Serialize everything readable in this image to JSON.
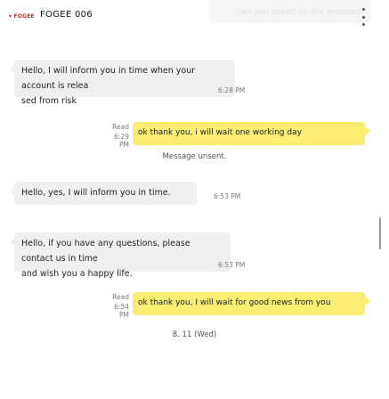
{
  "header": {
    "logo_text": "FOGEE",
    "title": "FOGEE 006",
    "ghost_text": "Can you speed up the process?",
    "menu_icon": "more-vertical-icon"
  },
  "messages": [
    {
      "direction": "in",
      "lines": [
        "Hello, I will inform you in time when your account is relea",
        "sed from risk"
      ],
      "time": "6:28 PM"
    },
    {
      "direction": "out",
      "text": "ok thank you, i will wait one working day",
      "read": "Read",
      "time": "6:29 PM"
    },
    {
      "direction": "system",
      "text": "Message unsent."
    },
    {
      "direction": "in",
      "lines": [
        "Hello, yes, I will inform you in time."
      ],
      "time": "6:53 PM"
    },
    {
      "direction": "in",
      "lines": [
        "Hello, if you have any questions, please contact us in time",
        "and wish you a happy life."
      ],
      "time": "6:53 PM"
    },
    {
      "direction": "out",
      "text": "ok thank you, I will wait for good news from you",
      "read": "Read",
      "time": "6:54 PM"
    }
  ],
  "date_divider": "8. 11 (Wed)",
  "colors": {
    "incoming_bubble": "#f0f0f0",
    "outgoing_bubble": "#f9ee73",
    "timestamp": "#7a7a7a"
  }
}
